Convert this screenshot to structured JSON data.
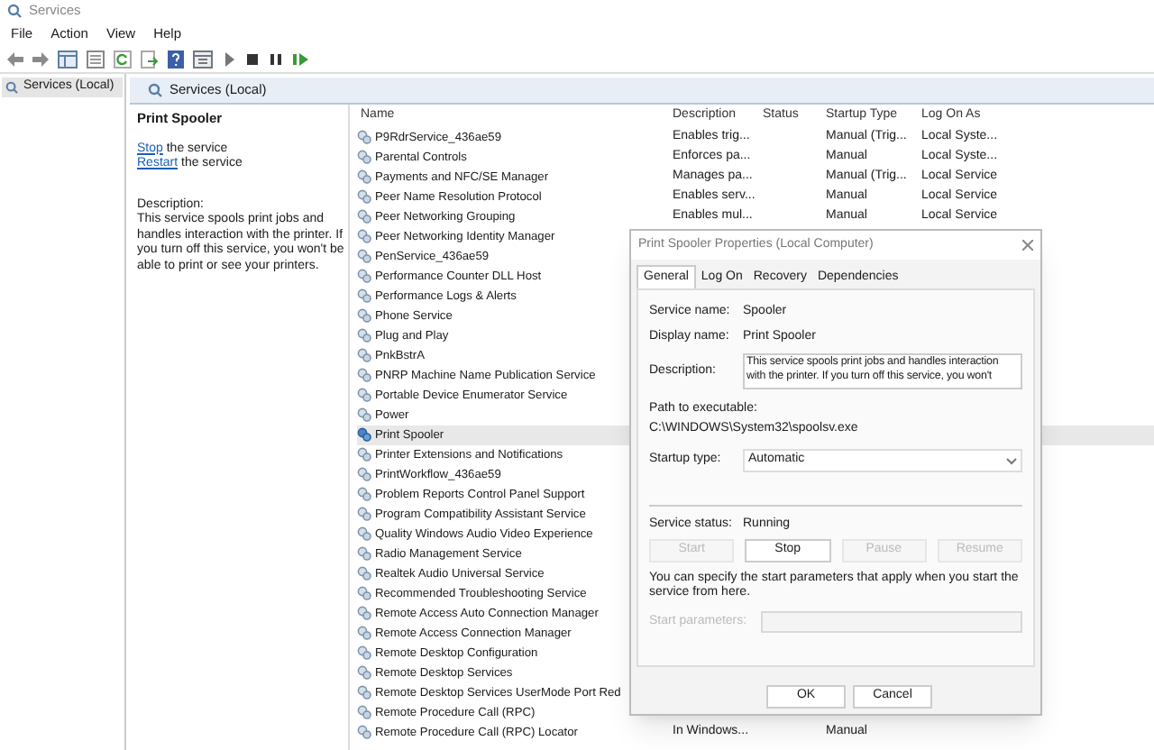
{
  "window": {
    "title": "Services"
  },
  "menu": [
    "File",
    "Action",
    "View",
    "Help"
  ],
  "tree": [
    {
      "label": "Services (Local)",
      "selected": true
    }
  ],
  "header": {
    "title": "Services (Local)"
  },
  "details": {
    "title": "Print Spooler",
    "actions": [
      {
        "link": "Stop",
        "text": "the service"
      },
      {
        "link": "Restart",
        "text": "the service"
      }
    ],
    "description_label": "Description:",
    "description": "This service spools print jobs and handles interaction with the printer. If you turn off this service, you won't be able to print or see your printers."
  },
  "columns": [
    "Name",
    "Description",
    "Status",
    "Startup Type",
    "Log On As"
  ],
  "rows": [
    {
      "name": "P9RdrService_436ae59",
      "description": "Enables trig...",
      "startup": "Manual (Trig...",
      "logon": "Local Syste...",
      "selected": false
    },
    {
      "name": "Parental Controls",
      "description": "Enforces pa...",
      "startup": "Manual",
      "logon": "Local Syste...",
      "selected": false
    },
    {
      "name": "Payments and NFC/SE Manager",
      "description": "Manages pa...",
      "startup": "Manual (Trig...",
      "logon": "Local Service",
      "selected": false
    },
    {
      "name": "Peer Name Resolution Protocol",
      "description": "Enables serv...",
      "startup": "Manual",
      "logon": "Local Service",
      "selected": false
    },
    {
      "name": "Peer Networking Grouping",
      "description": "Enables mul...",
      "startup": "Manual",
      "logon": "Local Service",
      "selected": false
    },
    {
      "name": "Peer Networking Identity Manager",
      "selected": false
    },
    {
      "name": "PenService_436ae59",
      "selected": false
    },
    {
      "name": "Performance Counter DLL Host",
      "selected": false
    },
    {
      "name": "Performance Logs & Alerts",
      "selected": false
    },
    {
      "name": "Phone Service",
      "selected": false
    },
    {
      "name": "Plug and Play",
      "selected": false
    },
    {
      "name": "PnkBstrA",
      "selected": false
    },
    {
      "name": "PNRP Machine Name Publication Service",
      "selected": false
    },
    {
      "name": "Portable Device Enumerator Service",
      "selected": false
    },
    {
      "name": "Power",
      "selected": false
    },
    {
      "name": "Print Spooler",
      "selected": true
    },
    {
      "name": "Printer Extensions and Notifications",
      "selected": false
    },
    {
      "name": "PrintWorkflow_436ae59",
      "selected": false
    },
    {
      "name": "Problem Reports Control Panel Support",
      "selected": false
    },
    {
      "name": "Program Compatibility Assistant Service",
      "selected": false
    },
    {
      "name": "Quality Windows Audio Video Experience",
      "selected": false
    },
    {
      "name": "Radio Management Service",
      "selected": false
    },
    {
      "name": "Realtek Audio Universal Service",
      "selected": false
    },
    {
      "name": "Recommended Troubleshooting Service",
      "selected": false
    },
    {
      "name": "Remote Access Auto Connection Manager",
      "selected": false
    },
    {
      "name": "Remote Access Connection Manager",
      "selected": false
    },
    {
      "name": "Remote Desktop Configuration",
      "selected": false
    },
    {
      "name": "Remote Desktop Services",
      "selected": false
    },
    {
      "name": "Remote Desktop Services UserMode Port Red",
      "selected": false
    },
    {
      "name": "Remote Procedure Call (RPC)",
      "selected": false
    },
    {
      "name": "Remote Procedure Call (RPC) Locator",
      "description": "In Windows...",
      "startup": "Manual",
      "selected": false
    }
  ],
  "dialog": {
    "title": "Print Spooler Properties (Local Computer)",
    "tabs": [
      {
        "label": "General",
        "selected": true
      },
      {
        "label": "Log On",
        "selected": false
      },
      {
        "label": "Recovery",
        "selected": false
      },
      {
        "label": "Dependencies",
        "selected": false
      }
    ],
    "service_name_label": "Service name:",
    "service_name": "Spooler",
    "display_name_label": "Display name:",
    "display_name": "Print Spooler",
    "description_label": "Description:",
    "description": "This service spools print jobs and handles interaction with the printer.  If you turn off this service, you won't",
    "path_label": "Path to executable:",
    "path": "C:\\WINDOWS\\System32\\spoolsv.exe",
    "startup_label": "Startup type:",
    "startup": "Automatic",
    "status_label": "Service status:",
    "status": "Running",
    "controls": [
      {
        "label": "Start",
        "disabled": true
      },
      {
        "label": "Stop",
        "disabled": false
      },
      {
        "label": "Pause",
        "disabled": true
      },
      {
        "label": "Resume",
        "disabled": true
      }
    ],
    "hint": "You can specify the start parameters that apply when you start the service from here.",
    "params_label": "Start parameters:",
    "params_disabled": true,
    "buttons": [
      "OK",
      "Cancel"
    ]
  }
}
